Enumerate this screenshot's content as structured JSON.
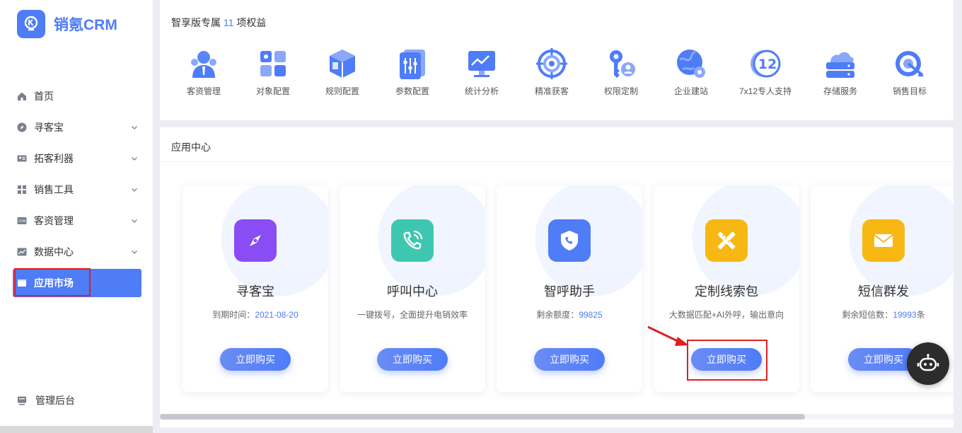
{
  "app": {
    "name": "销氪CRM",
    "brand_color": "#4f7cf7",
    "logo_icon": "lightbulb-k-icon"
  },
  "sidebar": {
    "items": [
      {
        "label": "首页",
        "icon": "home-icon",
        "expandable": false,
        "active": false
      },
      {
        "label": "寻客宝",
        "icon": "compass-icon",
        "expandable": true,
        "active": false
      },
      {
        "label": "拓客利器",
        "icon": "id-card-icon",
        "expandable": true,
        "active": false
      },
      {
        "label": "销售工具",
        "icon": "grid-icon",
        "expandable": true,
        "active": false
      },
      {
        "label": "客资管理",
        "icon": "crm-icon",
        "expandable": true,
        "active": false
      },
      {
        "label": "数据中心",
        "icon": "chart-icon",
        "expandable": true,
        "active": false
      },
      {
        "label": "应用市场",
        "icon": "shop-icon",
        "expandable": false,
        "active": true
      }
    ],
    "admin_label": "管理后台"
  },
  "benefits": {
    "title_prefix": "智享版专属",
    "count": "11",
    "title_suffix": "项权益",
    "items": [
      {
        "label": "客资管理",
        "icon": "customer-icon"
      },
      {
        "label": "对象配置",
        "icon": "object-config-icon"
      },
      {
        "label": "规则配置",
        "icon": "cube-rule-icon"
      },
      {
        "label": "参数配置",
        "icon": "sliders-icon"
      },
      {
        "label": "统计分析",
        "icon": "monitor-chart-icon"
      },
      {
        "label": "精准获客",
        "icon": "target-icon"
      },
      {
        "label": "权限定制",
        "icon": "key-user-icon"
      },
      {
        "label": "企业建站",
        "icon": "globe-gear-icon"
      },
      {
        "label": "7x12专人支持",
        "icon": "clock-12-icon"
      },
      {
        "label": "存储服务",
        "icon": "cloud-storage-icon"
      },
      {
        "label": "销售目标",
        "icon": "bullseye-icon"
      }
    ]
  },
  "app_center": {
    "title": "应用中心",
    "cards": [
      {
        "title": "寻客宝",
        "desc_prefix": "到期时间：",
        "desc_value": "2021-08-20",
        "desc_suffix": "",
        "button": "立即购买",
        "icon": "compass-icon",
        "color": "#8a4cf5"
      },
      {
        "title": "呼叫中心",
        "desc_prefix": "一键拨号，全面提升电销效率",
        "desc_value": "",
        "desc_suffix": "",
        "button": "立即购买",
        "icon": "phone-call-icon",
        "color": "#3ec7b0"
      },
      {
        "title": "智呼助手",
        "desc_prefix": "剩余额度：",
        "desc_value": "99825",
        "desc_suffix": "",
        "button": "立即购买",
        "icon": "shield-phone-icon",
        "color": "#4f7cf7"
      },
      {
        "title": "定制线索包",
        "desc_prefix": "大数据匹配+AI外呼，输出意向",
        "desc_value": "",
        "desc_suffix": "",
        "button": "立即购买",
        "icon": "ruler-pencil-icon",
        "color": "#f7b814"
      },
      {
        "title": "短信群发",
        "desc_prefix": "剩余短信数：",
        "desc_value": "19993",
        "desc_suffix": "条",
        "button": "立即购买",
        "icon": "envelope-icon",
        "color": "#f7b814"
      }
    ]
  },
  "floating": {
    "icon": "robot-icon"
  },
  "annotation_color": "#e02020"
}
